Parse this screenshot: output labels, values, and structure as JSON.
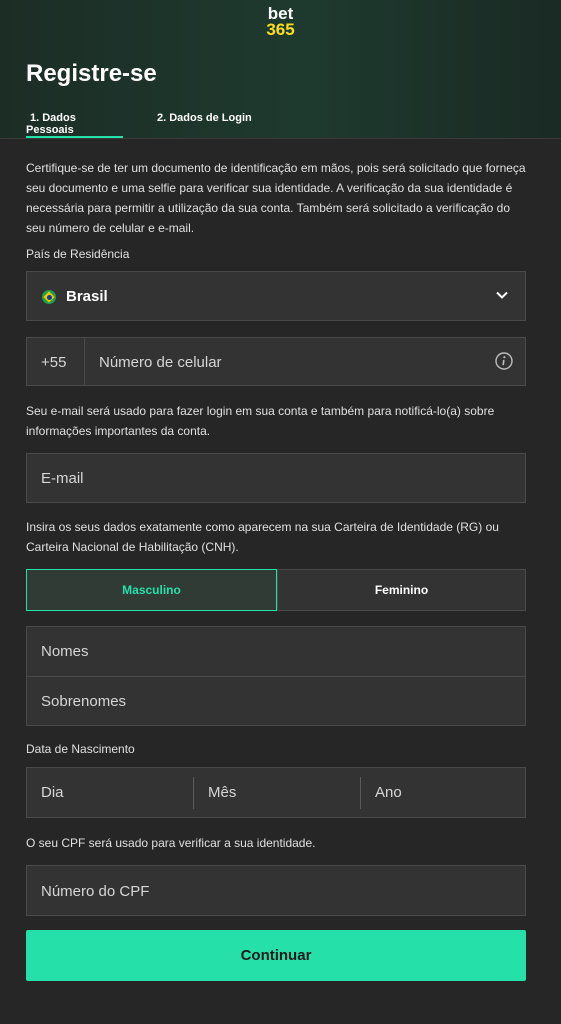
{
  "logo": {
    "line1": "bet",
    "line2": "365"
  },
  "page_title": "Registre-se",
  "tabs": [
    {
      "label": "1. Dados Pessoais"
    },
    {
      "label": "2. Dados de Login"
    }
  ],
  "intro_text": "Certifique-se de ter um documento de identificação em mãos, pois será solicitado que forneça seu documento e uma selfie para verificar sua identidade. A verificação da sua identidade é necessária para permitir a utilização da sua conta. Também será solicitado a verificação do seu número de celular e e-mail.",
  "country": {
    "label": "País de Residência",
    "value": "Brasil",
    "flag_icon": "brazil-flag-icon"
  },
  "phone": {
    "prefix": "+55",
    "placeholder": "Número de celular"
  },
  "email_note": "Seu e-mail será usado para fazer login em sua conta e também para notificá-lo(a) sobre informações importantes da conta.",
  "email": {
    "placeholder": "E-mail"
  },
  "id_note": "Insira os seus dados exatamente como aparecem na sua Carteira de Identidade (RG) ou Carteira Nacional de Habilitação (CNH).",
  "gender": {
    "options": [
      "Masculino",
      "Feminino"
    ],
    "selected": "Masculino"
  },
  "names": {
    "first_placeholder": "Nomes",
    "last_placeholder": "Sobrenomes"
  },
  "dob": {
    "label": "Data de Nascimento",
    "day": "Dia",
    "month": "Mês",
    "year": "Ano"
  },
  "cpf_note": "O seu CPF será usado para verificar a sua identidade.",
  "cpf": {
    "placeholder": "Número do CPF"
  },
  "continue_label": "Continuar",
  "colors": {
    "accent": "#26e0a9",
    "background": "#262626",
    "field": "#333333",
    "logo_yellow": "#ffdf1b"
  }
}
